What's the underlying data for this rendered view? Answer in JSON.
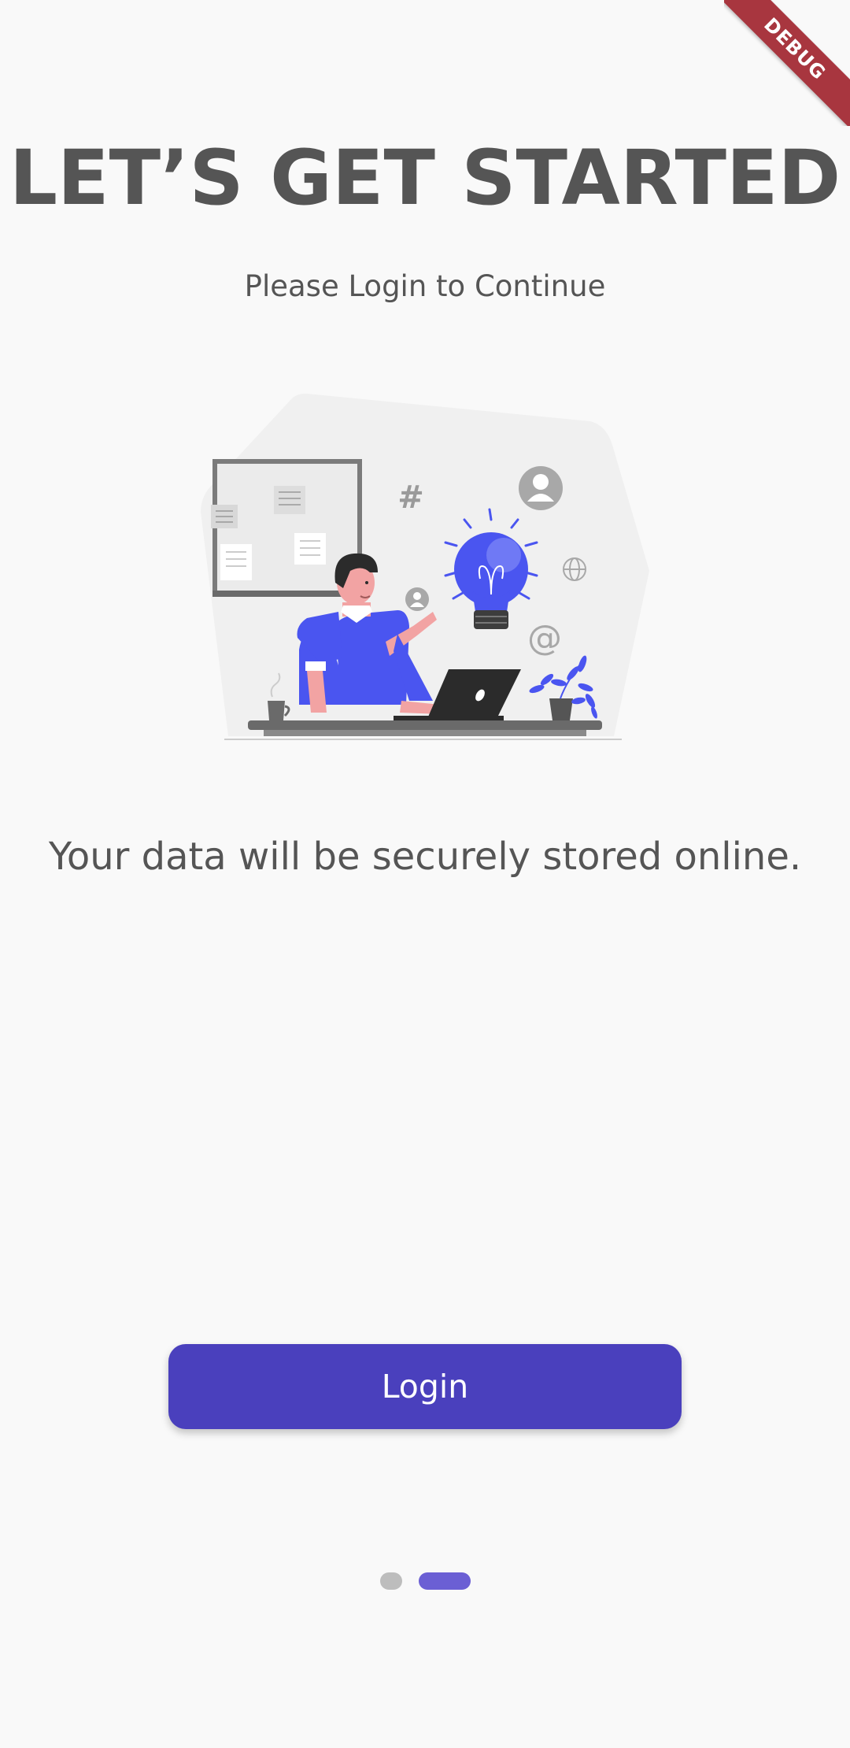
{
  "debug_banner": {
    "label": "DEBUG"
  },
  "header": {
    "title": "LET’S GET STARTED",
    "subtitle": "Please Login to Continue"
  },
  "illustration": {
    "icons": [
      "hash-icon",
      "user-avatar-icon",
      "globe-icon",
      "at-sign-icon",
      "lightbulb-icon",
      "laptop-icon",
      "plant-icon",
      "mug-icon"
    ]
  },
  "main": {
    "description": "Your data will be securely stored online."
  },
  "actions": {
    "login_label": "Login"
  },
  "pager": {
    "page_count": 2,
    "active_index": 1
  },
  "colors": {
    "background": "#f9f9f9",
    "text": "#555555",
    "primary": "#4a40bd",
    "indicator_active": "#6b5fd4",
    "indicator_inactive": "#bdbdbd",
    "debug_banner": "#a8363f",
    "illustration_accent": "#4a55f0"
  }
}
